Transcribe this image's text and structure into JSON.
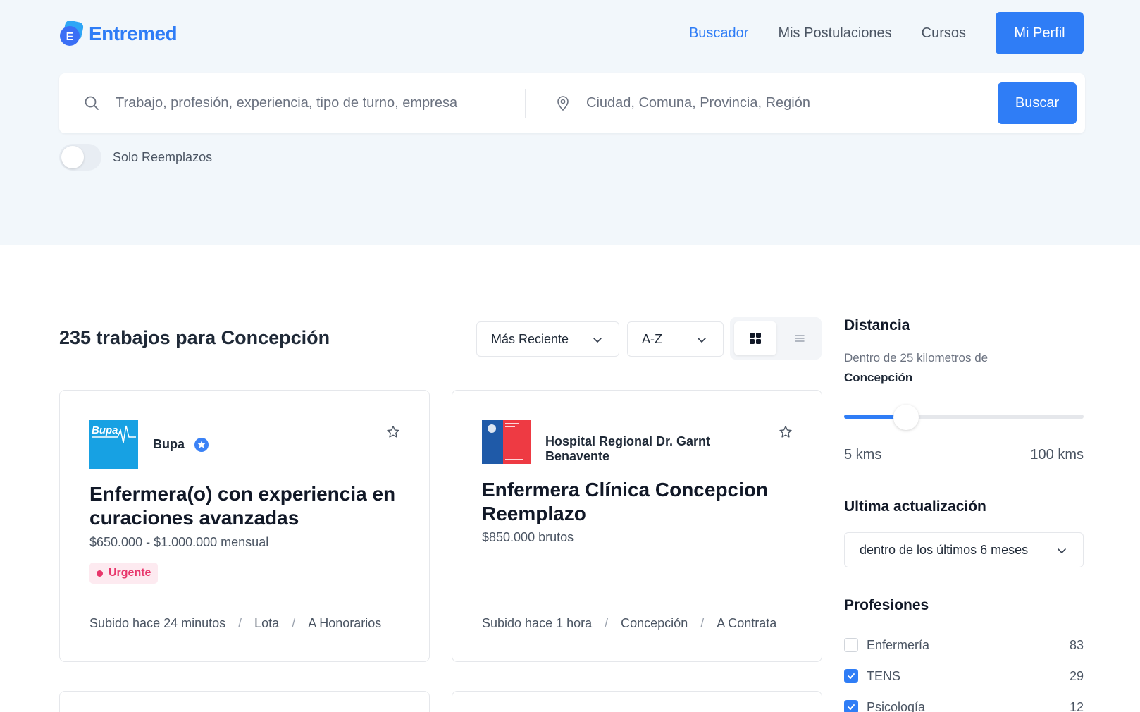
{
  "brand": {
    "name": "Entremed",
    "logo_letter": "E"
  },
  "nav": {
    "links": [
      {
        "label": "Buscador",
        "active": true
      },
      {
        "label": "Mis Postulaciones",
        "active": false
      },
      {
        "label": "Cursos",
        "active": false
      }
    ],
    "profile_label": "Mi Perfil"
  },
  "search": {
    "query_placeholder": "Trabajo, profesión, experiencia, tipo de turno, empresa",
    "location_placeholder": "Ciudad, Comuna, Provincia, Región",
    "button_label": "Buscar"
  },
  "filters": {
    "replacements_label": "Solo Reemplazos",
    "replacements_on": false
  },
  "results": {
    "count": "235 trabajos para",
    "city": "Concepción",
    "sort_label": "Más Reciente",
    "order_label": "A-Z",
    "view": "grid"
  },
  "jobs": [
    {
      "company": "Bupa",
      "company_logo_text": "Bupa",
      "verified": true,
      "title": "Enfermera(o) con experiencia en curaciones avanzadas",
      "salary": "$650.000 - $1.000.000 mensual",
      "badge": "Urgente",
      "posted": "Subido hace 24 minutos",
      "location": "Lota",
      "contract": "A Honorarios"
    },
    {
      "company": "Hospital Regional Dr. Garnt Benavente",
      "verified": false,
      "title": "Enfermera Clínica Concepcion Reemplazo",
      "salary": "$850.000 brutos",
      "badge": "",
      "posted": "Subido hace 1 hora",
      "location": "Concepción",
      "contract": "A Contrata"
    }
  ],
  "sidebar": {
    "distance_title": "Distancia",
    "distance_text": "Dentro de 25 kilometros de",
    "distance_city": "Concepción",
    "distance_value_fraction": 0.26,
    "range_min": "5 kms",
    "range_max": "100 kms",
    "update_title": "Ultima actualización",
    "update_value": "dentro de los últimos 6 meses",
    "professions_title": "Profesiones",
    "professions": [
      {
        "label": "Enfermería",
        "count": "83",
        "checked": false
      },
      {
        "label": "TENS",
        "count": "29",
        "checked": true
      },
      {
        "label": "Psicología",
        "count": "12",
        "checked": true
      }
    ]
  },
  "colors": {
    "accent": "#2f7df6",
    "hero_bg": "#f2f7fb",
    "urgent": "#e8366b"
  }
}
